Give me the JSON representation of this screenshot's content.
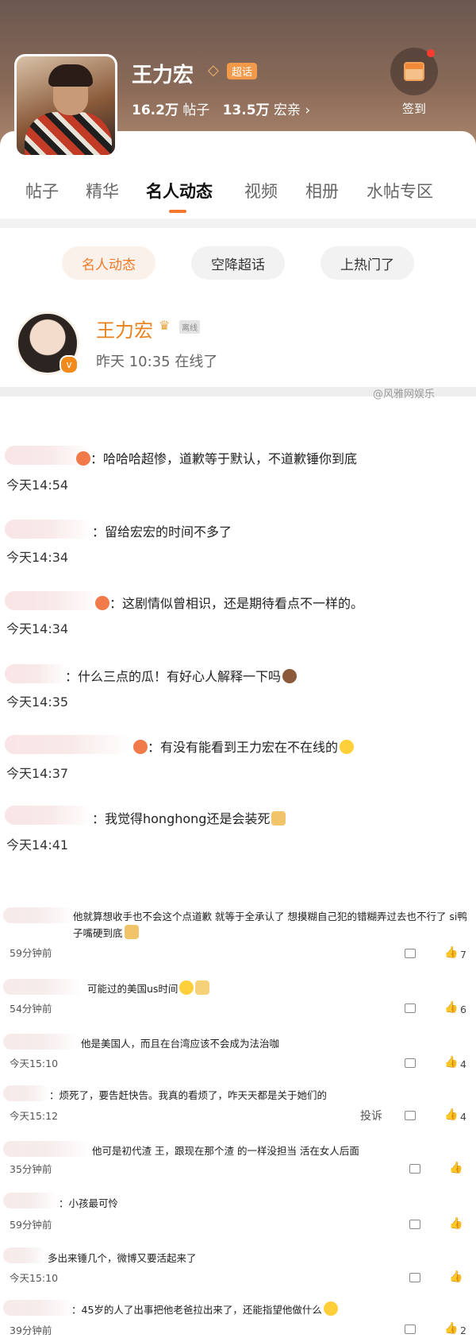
{
  "header": {
    "title": "王力宏",
    "badge": "超话",
    "posts_count": "16.2万",
    "posts_label": "帖子",
    "fans_count": "13.5万",
    "fans_label": "宏亲",
    "checkin_label": "签到",
    "accent": "#f5762c"
  },
  "tabs": [
    "帖子",
    "精华",
    "名人动态",
    "视频",
    "相册",
    "水帖专区"
  ],
  "chips": [
    "名人动态",
    "空降超话",
    "上热门了"
  ],
  "celebrity": {
    "name": "王力宏",
    "tag": "离线",
    "status": "昨天 10:35 在线了"
  },
  "watermark": "@风雅网娱乐",
  "comments": [
    {
      "text": "：哈哈哈超惨，道歉等于默认，不道歉锤你到底",
      "time": "今天14:54"
    },
    {
      "text": "：留给宏宏的时间不多了",
      "time": "今天14:34"
    },
    {
      "text": "：这剧情似曾相识，还是期待看点不一样的。",
      "time": "今天14:34"
    },
    {
      "text": "：什么三点的瓜！有好心人解释一下吗",
      "time": "今天14:35"
    },
    {
      "text": "：有没有能看到王力宏在不在线的",
      "time": "今天14:37"
    },
    {
      "text": "：我觉得honghong还是会装死",
      "time": "今天14:41"
    }
  ],
  "lower_comments": [
    {
      "text": "他就算想收手也不会这个点道歉 就等于全承认了 想摸糊自己犯的错糊弄过去也不行了 si鸭子嘴硬到底",
      "time": "59分钟前",
      "likes": "7"
    },
    {
      "text": "可能过的美国us时间",
      "time": "54分钟前",
      "likes": "6"
    },
    {
      "text": "他是美国人，而且在台湾应该不会成为法治咖",
      "time": "今天15:10",
      "likes": "4"
    },
    {
      "text": "：烦死了，要告赶快告。我真的看烦了，咋天天都是关于她们的",
      "time": "今天15:12",
      "likes": "4",
      "report": "投诉"
    },
    {
      "text": "他可是初代渣    王，跟现在那个渣    的一样没担当 活在女人后面",
      "time": "35分钟前",
      "likes": ""
    },
    {
      "text": "：小孩最可怜",
      "time": "59分钟前",
      "likes": ""
    },
    {
      "text": "多出来锤几个，微博又要活起来了",
      "time": "今天15:10",
      "likes": ""
    },
    {
      "text": "：45岁的人了出事把他老爸拉出来了，还能指望他做什么",
      "time": "39分钟前",
      "likes": "2"
    }
  ]
}
